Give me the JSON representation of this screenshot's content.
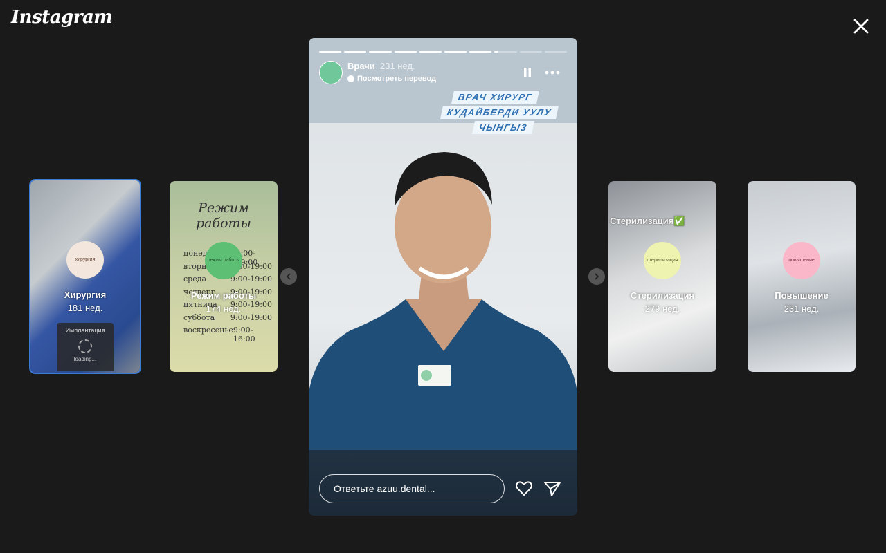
{
  "app": {
    "logo": "Instagram"
  },
  "story": {
    "username": "Врачи",
    "posted": "231 нед.",
    "translate_label": "Посмотреть перевод",
    "progress": [
      1,
      1,
      1,
      1,
      1,
      1,
      1,
      0.15,
      0,
      0
    ],
    "caption_lines": [
      "ВРАЧ ХИРУРГ",
      "КУДАЙБЕРДИ УУЛУ",
      "ЧЫНГЫЗ"
    ],
    "reply_placeholder": "Ответьте azuu.dental..."
  },
  "highlights": [
    {
      "title": "Хирургия",
      "age": "181 нед.",
      "ring_text": "хирургия",
      "ring_color": "#f3e6dc",
      "loading": {
        "title": "Имплантация",
        "status": "loading..."
      }
    },
    {
      "title": "Режим работы",
      "age": "174 нед.",
      "ring_text": "режим работы",
      "ring_color": "#5cbf73",
      "schedule_title": "Режим работы",
      "schedule": [
        {
          "day": "понедельник",
          "time": "9:00-19:00"
        },
        {
          "day": "вторник",
          "time": "9:00-19:00"
        },
        {
          "day": "среда",
          "time": "9:00-19:00"
        },
        {
          "day": "четверг",
          "time": "9:00-19:00"
        },
        {
          "day": "пятница",
          "time": "9:00-19:00"
        },
        {
          "day": "суббота",
          "time": "9:00-19:00"
        },
        {
          "day": "воскресенье",
          "time": "9:00-16:00"
        }
      ]
    },
    {
      "title": "Стерилизация",
      "age": "279 нед.",
      "ring_text": "стерилизация",
      "ring_color": "#eef3b0",
      "overlay_text": "Стерилизация✅"
    },
    {
      "title": "Повышение",
      "age": "231 нед.",
      "ring_text": "повышение",
      "ring_color": "#f9b7c9"
    }
  ],
  "colors": {
    "background": "#1a1a1a",
    "active_border": "#3a7bd5",
    "caption": "#2d6fb2"
  }
}
